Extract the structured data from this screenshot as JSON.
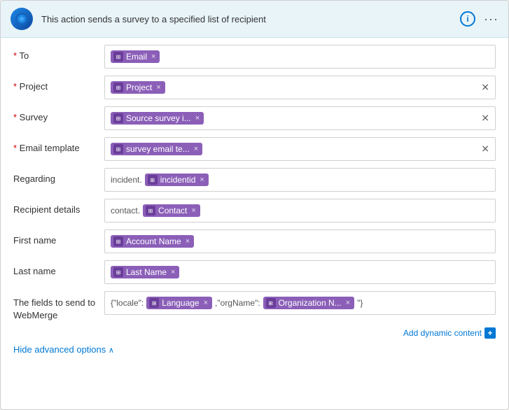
{
  "header": {
    "title": "This action sends a survey to a specified list of recipient",
    "icon_char": "✦",
    "info_label": "i",
    "more_label": "···"
  },
  "form": {
    "rows": [
      {
        "id": "to",
        "label": "To",
        "required": true,
        "tokens": [
          {
            "id": "email-token",
            "text": "Email"
          }
        ],
        "has_clear": false
      },
      {
        "id": "project",
        "label": "Project",
        "required": true,
        "tokens": [
          {
            "id": "project-token",
            "text": "Project"
          }
        ],
        "has_clear": true
      },
      {
        "id": "survey",
        "label": "Survey",
        "required": true,
        "tokens": [
          {
            "id": "survey-token",
            "text": "Source survey i..."
          }
        ],
        "has_clear": true
      },
      {
        "id": "email-template",
        "label": "Email template",
        "required": true,
        "tokens": [
          {
            "id": "email-template-token",
            "text": "survey email te..."
          }
        ],
        "has_clear": true
      },
      {
        "id": "regarding",
        "label": "Regarding",
        "required": false,
        "prefix_text": "incident.",
        "tokens": [
          {
            "id": "incidentid-token",
            "text": "incidentid"
          }
        ],
        "has_clear": false
      },
      {
        "id": "recipient-details",
        "label": "Recipient details",
        "required": false,
        "prefix_text": "contact.",
        "tokens": [
          {
            "id": "contact-token",
            "text": "Contact"
          }
        ],
        "has_clear": false
      },
      {
        "id": "first-name",
        "label": "First name",
        "required": false,
        "tokens": [
          {
            "id": "account-name-token",
            "text": "Account Name"
          }
        ],
        "has_clear": false
      },
      {
        "id": "last-name",
        "label": "Last name",
        "required": false,
        "tokens": [
          {
            "id": "last-name-token",
            "text": "Last Name"
          }
        ],
        "has_clear": false
      }
    ],
    "webmerge": {
      "label": "The fields to send to WebMerge",
      "prefix_text": "{\"locale\":",
      "tokens": [
        {
          "id": "language-token",
          "text": "Language"
        },
        {
          "id": "org-name-token",
          "text": "Organization N..."
        }
      ],
      "suffix_text": ",\"orgName\":",
      "cursor_text": "\"}"
    },
    "add_dynamic_content": "Add dynamic content",
    "hide_advanced_label": "Hide advanced options"
  }
}
